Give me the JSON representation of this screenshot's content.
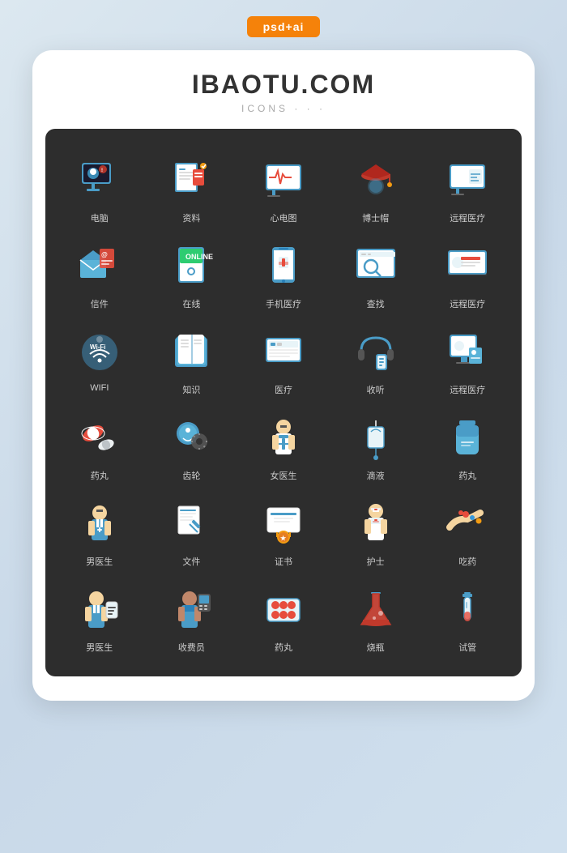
{
  "badge": "psd+ai",
  "title": "IBAOTU.COM",
  "subtitle": "ICONS · · ·",
  "icons": [
    {
      "id": "computer",
      "label": "电脑",
      "type": "computer"
    },
    {
      "id": "document",
      "label": "资料",
      "type": "document"
    },
    {
      "id": "ecg",
      "label": "心电图",
      "type": "ecg"
    },
    {
      "id": "graduation",
      "label": "博士帽",
      "type": "graduation"
    },
    {
      "id": "telemedicine1",
      "label": "远程医疗",
      "type": "telemedicine1"
    },
    {
      "id": "letter",
      "label": "信件",
      "type": "letter"
    },
    {
      "id": "online",
      "label": "在线",
      "type": "online"
    },
    {
      "id": "mobile-medical",
      "label": "手机医疗",
      "type": "mobile-medical"
    },
    {
      "id": "search",
      "label": "查找",
      "type": "search"
    },
    {
      "id": "telemedicine2",
      "label": "远程医疗",
      "type": "telemedicine2"
    },
    {
      "id": "wifi",
      "label": "WIFI",
      "type": "wifi"
    },
    {
      "id": "knowledge",
      "label": "知识",
      "type": "knowledge"
    },
    {
      "id": "medical",
      "label": "医疗",
      "type": "medical"
    },
    {
      "id": "headphone",
      "label": "收听",
      "type": "headphone"
    },
    {
      "id": "telemedicine3",
      "label": "远程医疗",
      "type": "telemedicine3"
    },
    {
      "id": "pills",
      "label": "药丸",
      "type": "pills"
    },
    {
      "id": "gearhead",
      "label": "齿轮",
      "type": "gearhead"
    },
    {
      "id": "female-doctor",
      "label": "女医生",
      "type": "female-doctor"
    },
    {
      "id": "drip",
      "label": "滴液",
      "type": "drip"
    },
    {
      "id": "medicine-bottle",
      "label": "药丸",
      "type": "medicine-bottle"
    },
    {
      "id": "male-doctor",
      "label": "男医生",
      "type": "male-doctor"
    },
    {
      "id": "file",
      "label": "文件",
      "type": "file"
    },
    {
      "id": "certificate",
      "label": "证书",
      "type": "certificate"
    },
    {
      "id": "nurse",
      "label": "护士",
      "type": "nurse"
    },
    {
      "id": "take-medicine",
      "label": "吃药",
      "type": "take-medicine"
    },
    {
      "id": "male-doctor2",
      "label": "男医生",
      "type": "male-doctor2"
    },
    {
      "id": "cashier",
      "label": "收费员",
      "type": "cashier"
    },
    {
      "id": "pill-pack",
      "label": "药丸",
      "type": "pill-pack"
    },
    {
      "id": "flask",
      "label": "烧瓶",
      "type": "flask"
    },
    {
      "id": "test-tube",
      "label": "试管",
      "type": "test-tube"
    }
  ]
}
